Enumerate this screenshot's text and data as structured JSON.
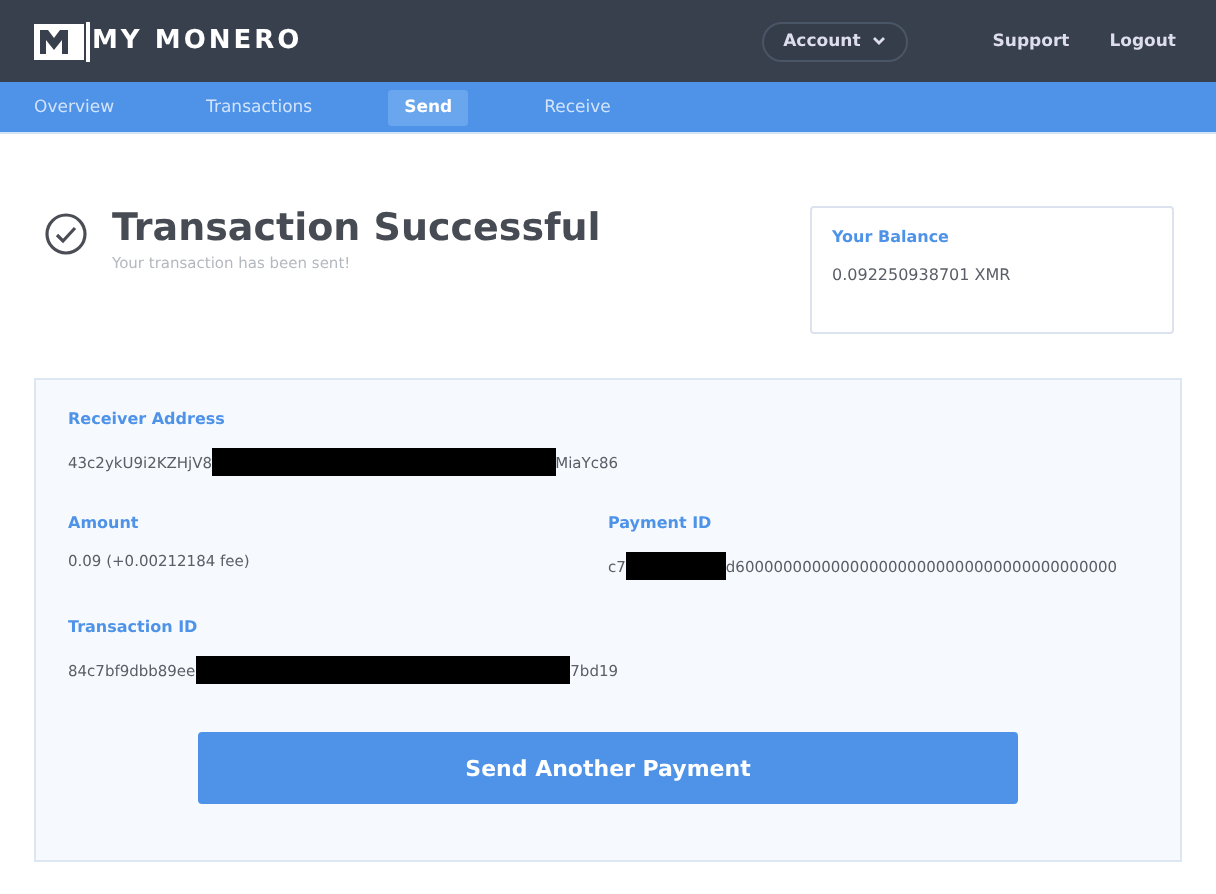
{
  "header": {
    "logo_text": "MY MONERO",
    "account": "Account",
    "links": [
      "Support",
      "Logout"
    ]
  },
  "nav": [
    {
      "label": "Overview",
      "selected": false
    },
    {
      "label": "Transactions",
      "selected": false
    },
    {
      "label": "Send",
      "selected": true
    },
    {
      "label": "Receive",
      "selected": false
    }
  ],
  "status": {
    "title": "Transaction Successful",
    "subtitle": "Your transaction has been sent!"
  },
  "balance": {
    "label": "Your Balance",
    "value": "0.092250938701 XMR"
  },
  "detail_rows": [
    [
      {
        "label": "Receiver Address",
        "before": "43c2ykU9i2KZHjV8",
        "after": "MiaYc86"
      }
    ],
    [
      {
        "label": "Amount",
        "value": "0.09 (+0.00212184 fee)"
      },
      {
        "label": "Payment ID",
        "before": "c7",
        "after": "d6000000000000000000000000000000000000000"
      }
    ],
    [
      {
        "label": "Transaction ID",
        "before": "84c7bf9dbb89ee",
        "after": "7bd19"
      }
    ]
  ],
  "button": "Send Another Payment"
}
